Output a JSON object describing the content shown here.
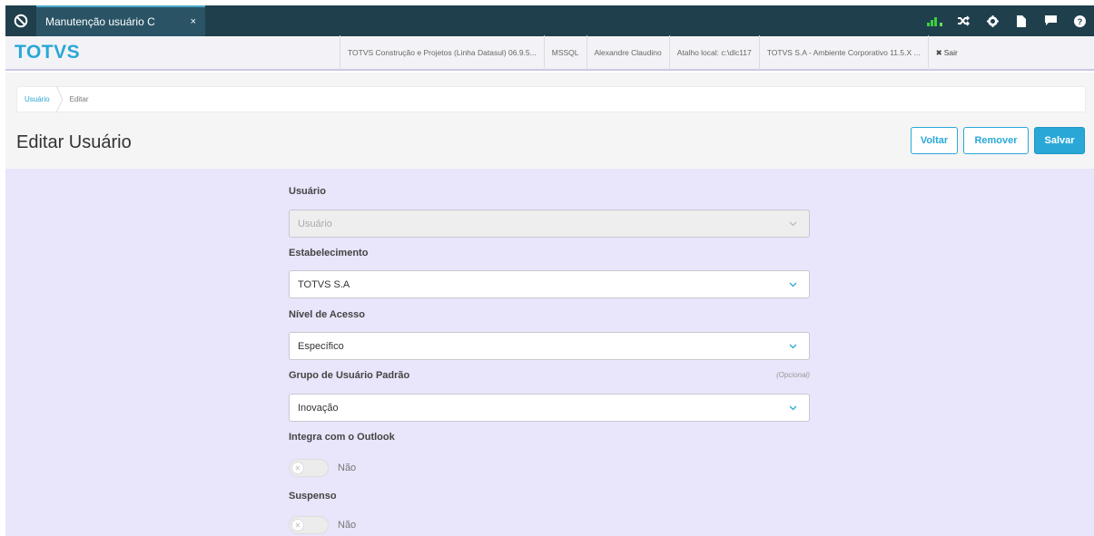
{
  "tab": {
    "label": "Manutenção usuário C",
    "close": "×"
  },
  "top_icons": [
    "signal-icon",
    "shuffle-icon",
    "gear-icon",
    "document-icon",
    "chat-icon",
    "help-icon"
  ],
  "brand": "TOTVS",
  "header_info": [
    "TOTVS Construção e Projetos (Linha Datasul) 06.9.5...",
    "MSSQL",
    "Alexandre Claudino",
    "Atalho local: c:\\dlc117",
    "TOTVS S.A - Ambiente Corporativo 11.5.X ..."
  ],
  "exit": {
    "icon": "✖",
    "label": "Sair"
  },
  "breadcrumb": {
    "link": "Usuário",
    "current": "Editar"
  },
  "page_title": "Editar Usuário",
  "actions": {
    "back": "Voltar",
    "remove": "Remover",
    "save": "Salvar"
  },
  "form": {
    "usuario": {
      "label": "Usuário",
      "placeholder": "Usuário"
    },
    "estabelecimento": {
      "label": "Estabelecimento",
      "value": "TOTVS S.A"
    },
    "nivel_acesso": {
      "label": "Nível de Acesso",
      "value": "Específico"
    },
    "grupo_padrao": {
      "label": "Grupo de Usuário Padrão",
      "optional": "(Opcional)",
      "value": "Inovação"
    },
    "outlook": {
      "label": "Integra com o Outlook",
      "state": "Não"
    },
    "suspenso": {
      "label": "Suspenso",
      "state": "Não"
    }
  },
  "colors": {
    "accent": "#29a8d8",
    "topbar": "#1f3f4d",
    "form_bg": "#e9e5fb"
  }
}
